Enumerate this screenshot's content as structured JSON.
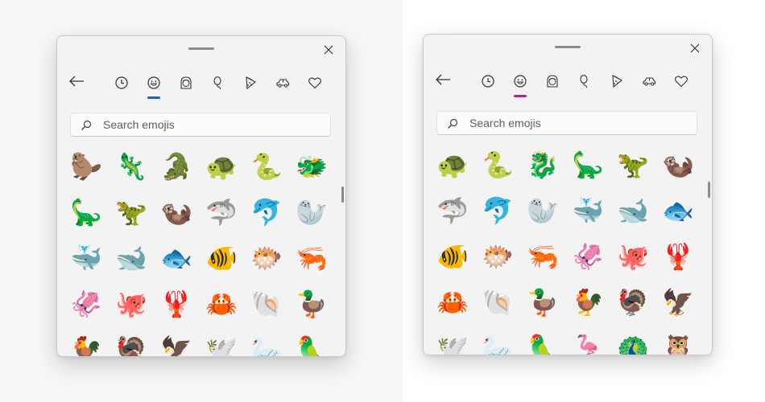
{
  "panels": [
    {
      "id": "a",
      "accent": "#1a63b8",
      "active_tab": 1,
      "emoji_style": "outlined",
      "search": {
        "placeholder": "Search emojis",
        "value": ""
      },
      "tabs": [
        {
          "label": "Recently used",
          "icon": "clock-icon"
        },
        {
          "label": "Smileys and animals",
          "icon": "smiley-icon"
        },
        {
          "label": "People",
          "icon": "person-icon"
        },
        {
          "label": "Celebrations and objects",
          "icon": "balloon-icon"
        },
        {
          "label": "Food and plants",
          "icon": "pizza-icon"
        },
        {
          "label": "Transportation and places",
          "icon": "car-icon"
        },
        {
          "label": "Symbols",
          "icon": "heart-icon"
        }
      ],
      "emojis": [
        [
          "🦫",
          "🦎",
          "🐊",
          "🐢",
          "🐍",
          "🐲"
        ],
        [
          "🦕",
          "🦖",
          "🦦",
          "🦈",
          "🐬",
          "🦭"
        ],
        [
          "🐳",
          "🐋",
          "🐟",
          "🐠",
          "🐡",
          "🦐"
        ],
        [
          "🦑",
          "🐙",
          "🦞",
          "🦀",
          "🐚",
          "🦆"
        ],
        [
          "🐓",
          "🦃",
          "🦅",
          "🕊️",
          "🦢",
          "🦜"
        ]
      ]
    },
    {
      "id": "b",
      "accent": "#b0249b",
      "active_tab": 1,
      "emoji_style": "flat",
      "search": {
        "placeholder": "Search emojis",
        "value": ""
      },
      "tabs": [
        {
          "label": "Recently used",
          "icon": "clock-icon"
        },
        {
          "label": "Smileys and animals",
          "icon": "smiley-icon"
        },
        {
          "label": "People",
          "icon": "person-icon"
        },
        {
          "label": "Celebrations and objects",
          "icon": "balloon-icon"
        },
        {
          "label": "Food and plants",
          "icon": "pizza-icon"
        },
        {
          "label": "Transportation and places",
          "icon": "car-icon"
        },
        {
          "label": "Symbols",
          "icon": "heart-icon"
        }
      ],
      "emojis": [
        [
          "🐢",
          "🐍",
          "🐉",
          "🦕",
          "🦖",
          "🦦"
        ],
        [
          "🦈",
          "🐬",
          "🦭",
          "🐳",
          "🐋",
          "🐟"
        ],
        [
          "🐠",
          "🐡",
          "🦐",
          "🦑",
          "🐙",
          "🦞"
        ],
        [
          "🦀",
          "🐚",
          "🦆",
          "🐓",
          "🦃",
          "🦅"
        ],
        [
          "🕊️",
          "🦢",
          "🦜",
          "🦩",
          "🦚",
          "🦉"
        ]
      ]
    }
  ]
}
